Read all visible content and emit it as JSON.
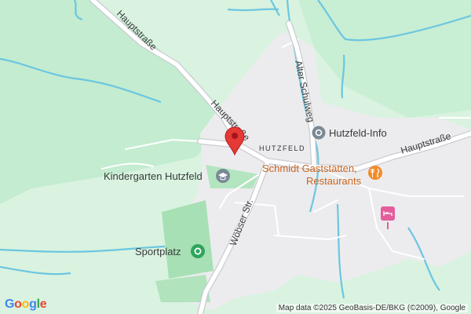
{
  "map": {
    "colors": {
      "background": "#d9f3e0",
      "forest": "#b7e7c6",
      "settlement": "#ececee",
      "road": "#ffffff",
      "road_edge": "#c9ccd2",
      "water": "#6cc6e0",
      "park": "#a7e0b4",
      "pin": "#e53935"
    },
    "roads": {
      "hauptstrasse_nw_1": "Hauptstraße",
      "hauptstrasse_nw_2": "Hauptstraße",
      "hauptstrasse_e": "Hauptstraße",
      "alter_schulweg": "Alter Schulweg",
      "wobser_str": "Wöbser Str."
    },
    "place_label": "HUTZFELD",
    "pois": {
      "hutzfeld_info": {
        "label": "Hutzfeld-Info",
        "icon": "info-pin-icon"
      },
      "restaurant": {
        "line1": "Schmidt Gaststätten,",
        "line2": "Restaurants",
        "icon": "restaurant-icon"
      },
      "kindergarten": {
        "label": "Kindergarten Hutzfeld",
        "icon": "school-icon"
      },
      "sportplatz": {
        "label": "Sportplatz",
        "icon": "park-icon"
      },
      "hotel": {
        "icon": "hotel-bed-icon"
      }
    },
    "marker": {
      "icon": "location-pin-icon"
    }
  },
  "logo": {
    "letters": [
      "G",
      "o",
      "o",
      "g",
      "l",
      "e"
    ],
    "colors": [
      "#4285F4",
      "#EA4335",
      "#FBBC05",
      "#4285F4",
      "#34A853",
      "#EA4335"
    ]
  },
  "attribution": "Map data ©2025 GeoBasis-DE/BKG (©2009), Google"
}
